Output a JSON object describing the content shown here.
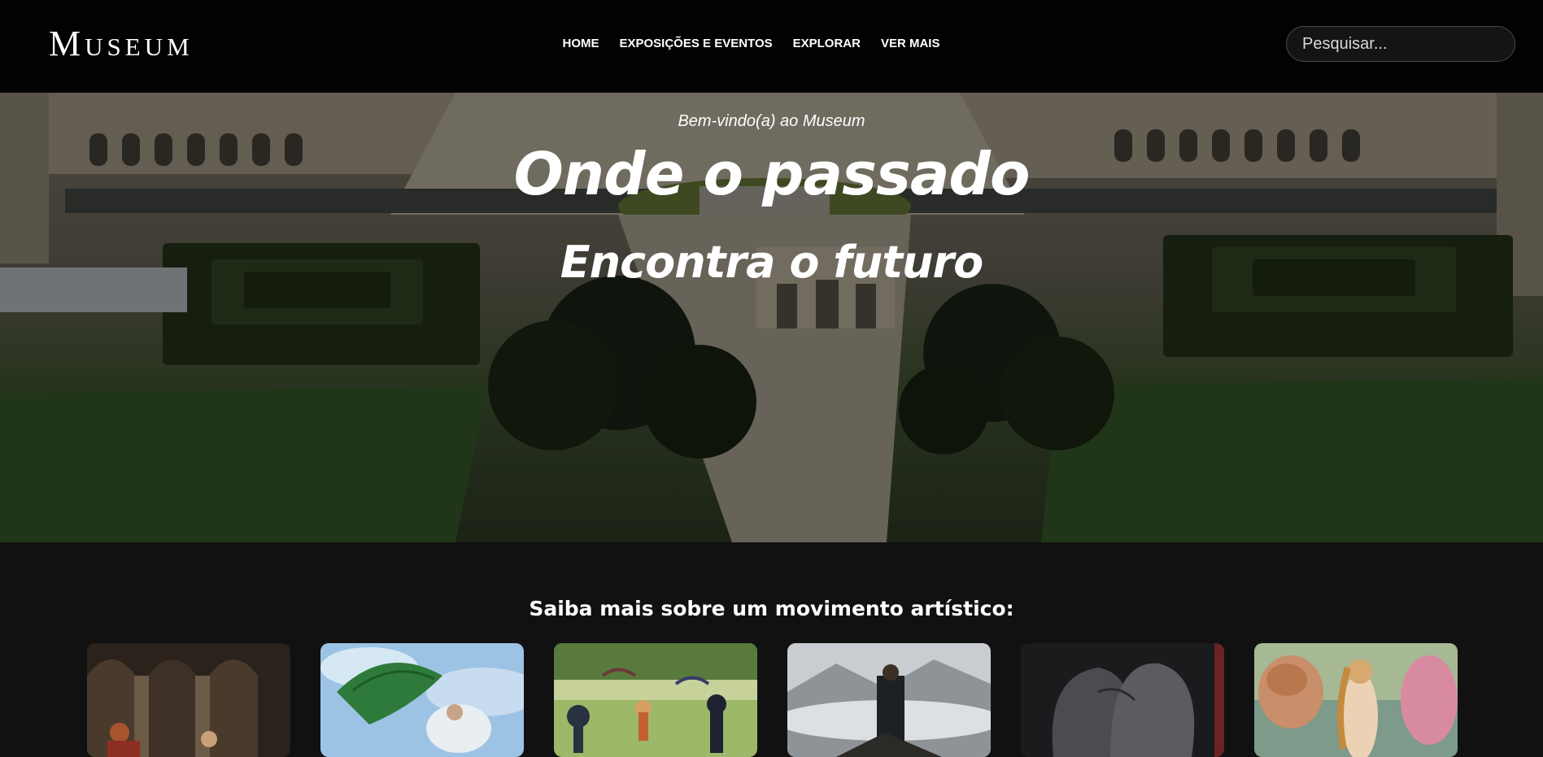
{
  "header": {
    "logo": "Museum",
    "nav": [
      "HOME",
      "EXPOSIÇÕES E EVENTOS",
      "EXPLORAR",
      "VER MAIS"
    ],
    "search_placeholder": "Pesquisar..."
  },
  "hero": {
    "welcome": "Bem-vindo(a) ao Museum",
    "title_line1": "Onde o passado",
    "title_line2": "Encontra o futuro",
    "image": "aerial-view-louvre-tuileries"
  },
  "movements": {
    "heading": "Saiba mais sobre um movimento artístico:",
    "cards": [
      {
        "image": "neoclassical-painting-thumbnail"
      },
      {
        "image": "impressionist-parasol-painting-thumbnail"
      },
      {
        "image": "pointillist-park-painting-thumbnail"
      },
      {
        "image": "romantic-wanderer-painting-thumbnail"
      },
      {
        "image": "surrealist-lovers-painting-thumbnail"
      },
      {
        "image": "renaissance-venus-painting-thumbnail"
      }
    ]
  },
  "colors": {
    "header_bg": "#020202",
    "page_bg": "#111111",
    "text": "#ffffff"
  }
}
